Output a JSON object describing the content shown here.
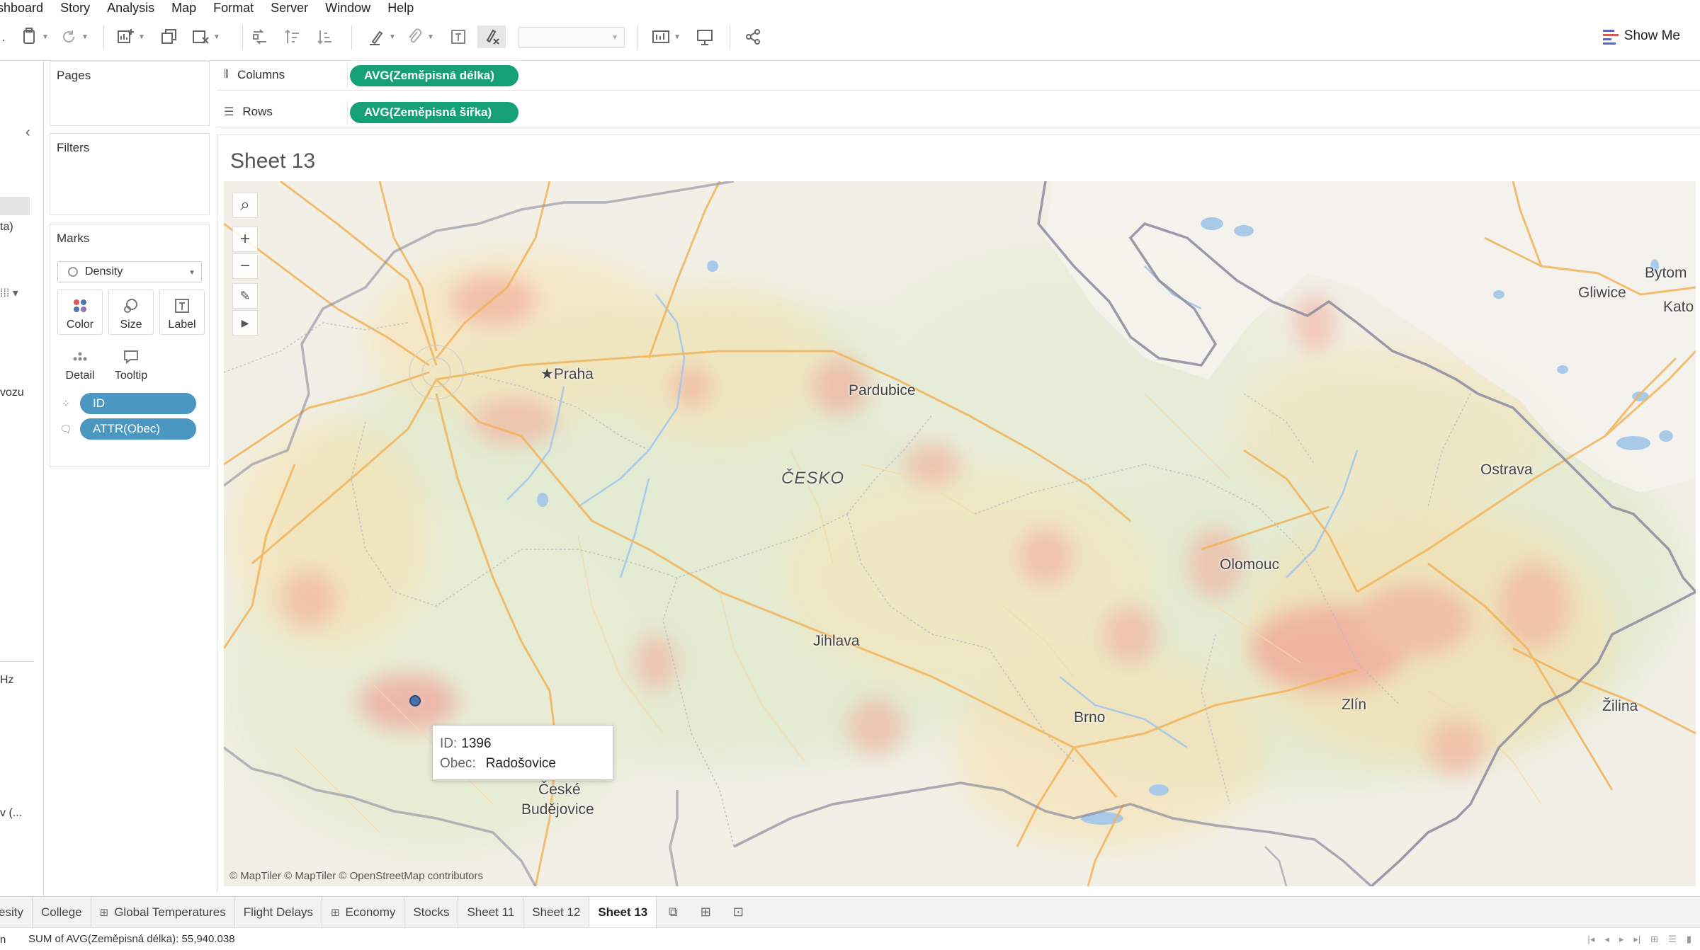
{
  "menu": [
    "shboard",
    "Story",
    "Analysis",
    "Map",
    "Format",
    "Server",
    "Window",
    "Help"
  ],
  "toolbar": {
    "show_me_label": "Show Me"
  },
  "data_pane": {
    "fragments": [
      "ta)",
      "vozu",
      "Hz",
      "v (..."
    ]
  },
  "cards": {
    "pages_title": "Pages",
    "filters_title": "Filters",
    "marks_title": "Marks",
    "mark_type": "Density",
    "buttons": [
      "Color",
      "Size",
      "Label",
      "Detail",
      "Tooltip"
    ],
    "pills": [
      "ID",
      "ATTR(Obec)"
    ]
  },
  "shelves": {
    "columns_label": "Columns",
    "columns_pill": "AVG(Zeměpisná délka)",
    "rows_label": "Rows",
    "rows_pill": "AVG(Zeměpisná šířka)"
  },
  "sheet": {
    "title": "Sheet 13"
  },
  "map": {
    "places": [
      "Praha",
      "Pardubice",
      "ČESKO",
      "Ostrava",
      "Olomouc",
      "Jihlava",
      "Brno",
      "Zlín",
      "Žilina",
      "České",
      "Budějovice",
      "Gliwice",
      "Bytom",
      "Kato"
    ],
    "attribution": "© MapTiler © MapTiler © OpenStreetMap contributors",
    "tooltip": {
      "id_key": "ID:",
      "id_value": "1396",
      "obec_key": "Obec:",
      "obec_value": "Radošovice"
    }
  },
  "tabs": [
    "esity",
    "College",
    "Global Temperatures",
    "Flight Delays",
    "Economy",
    "Stocks",
    "Sheet 11",
    "Sheet 12",
    "Sheet 13"
  ],
  "status": {
    "cut": "n",
    "text": "SUM of AVG(Zeměpisná délka): 55,940.038"
  }
}
